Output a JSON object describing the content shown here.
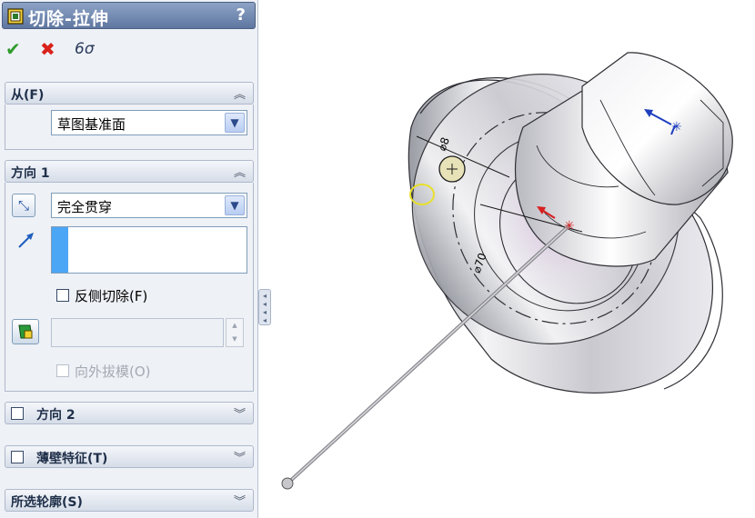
{
  "panel": {
    "title": "切除-拉伸",
    "help": "?",
    "actions": {
      "ok_icon": "✔",
      "cancel_icon": "✖",
      "preview_icon": "6σ"
    },
    "from": {
      "title": "从(F)",
      "chevron": "≈",
      "value": "草图基准面"
    },
    "direction1": {
      "title": "方向 1",
      "chevron": "≈",
      "end_condition": "完全贯穿",
      "flip_side_label": "反侧切除(F)",
      "draft_outward_label": "向外拔模(O)"
    },
    "direction2": {
      "title": "方向 2",
      "chevron": "≈"
    },
    "thin_feature": {
      "title": "薄壁特征(T)",
      "chevron": "≈"
    },
    "selected_contours": {
      "title": "所选轮廓(S)",
      "chevron": "≈"
    }
  },
  "viewport": {
    "dim_small": "⌀8",
    "dim_large": "⌀70"
  }
}
